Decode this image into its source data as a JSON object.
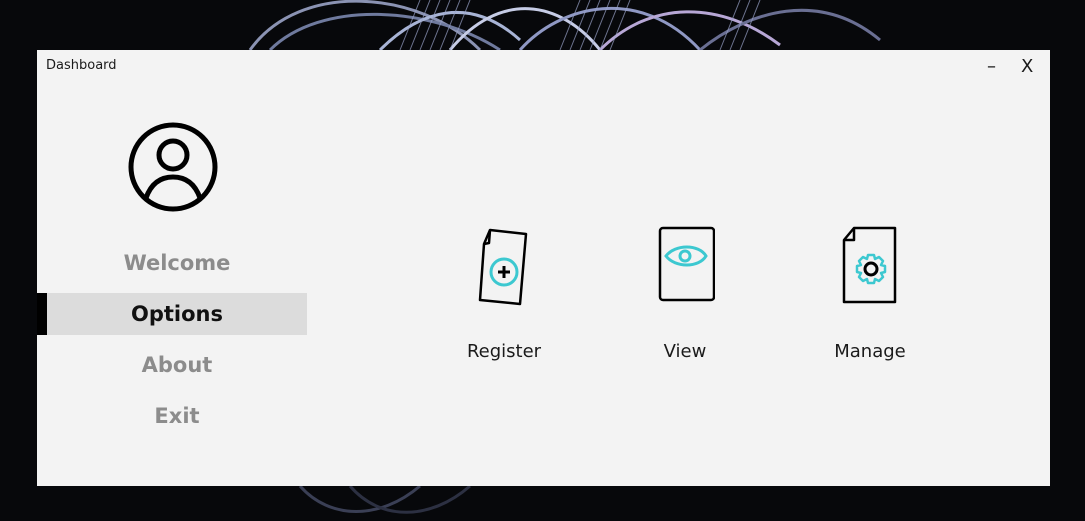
{
  "window": {
    "title": "Dashboard",
    "minimize_label": "–",
    "close_label": "X"
  },
  "sidebar": {
    "avatar_icon": "user-circle-icon",
    "items": [
      {
        "label": "Welcome",
        "active": false
      },
      {
        "label": "Options",
        "active": true
      },
      {
        "label": "About",
        "active": false
      },
      {
        "label": "Exit",
        "active": false
      }
    ]
  },
  "main": {
    "tiles": [
      {
        "label": "Register",
        "icon": "document-add-icon"
      },
      {
        "label": "View",
        "icon": "document-eye-icon"
      },
      {
        "label": "Manage",
        "icon": "document-gear-icon"
      }
    ]
  },
  "colors": {
    "accent": "#3cc8d0",
    "window_bg": "#f3f3f3",
    "active_item_bg": "#dcdcdc",
    "inactive_text": "#8c8c8c",
    "desktop_bg": "#07080b"
  }
}
